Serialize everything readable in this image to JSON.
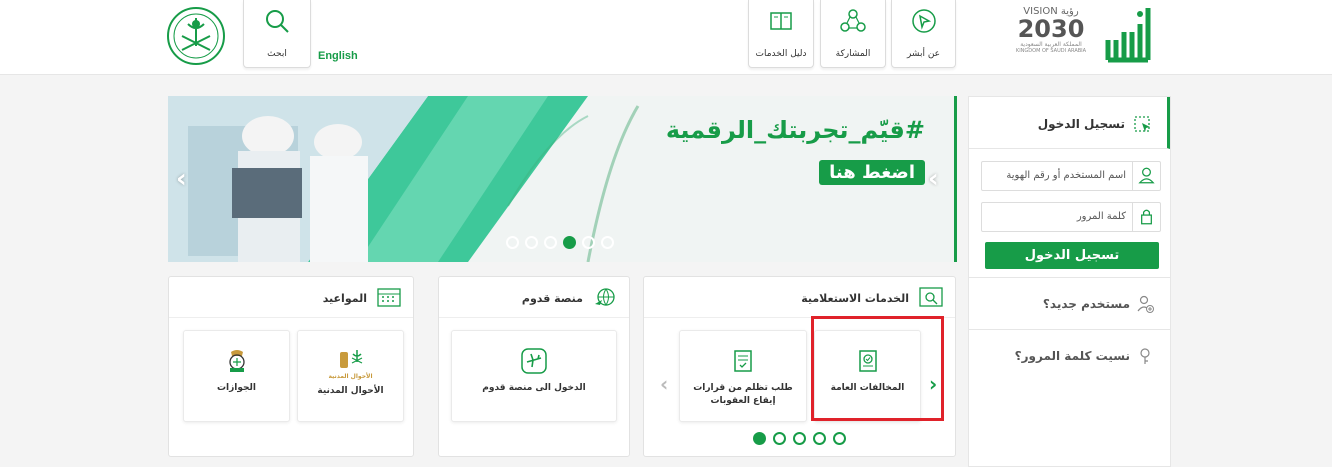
{
  "header": {
    "search_label": "ابحث",
    "english_label": "English",
    "guide_label": "دليل الخدمات",
    "participation_label": "المشاركة",
    "about_label": "عن أبشر",
    "vision_text": "VISION رؤية",
    "vision_year": "2030",
    "kingdom_ar": "المملكة العربية السعودية",
    "kingdom_en": "KINGDOM OF SAUDI ARABIA"
  },
  "banner": {
    "hashtag": "#قيّم_تجربتك_الرقمية",
    "cta": "اضغط هنا",
    "slide_count": 6,
    "active_slide": 3
  },
  "login": {
    "title": "تسجيل الدخول",
    "username_placeholder": "اسم المستخدم أو رقم الهوية",
    "password_placeholder": "كلمة المرور",
    "submit_label": "تسجيل الدخول",
    "new_user": "مستخدم جديد؟",
    "forgot_password": "نسيت كلمة المرور؟"
  },
  "inquiry": {
    "title": "الخدمات الاستعلامية",
    "tiles": [
      {
        "label": "المخالفات العامة"
      },
      {
        "label": "طلب تظلم من قرارات إيقاع العقوبات"
      }
    ],
    "page_count": 5,
    "active_page": 0
  },
  "qudoom": {
    "title": "منصة قدوم",
    "tiles": [
      {
        "label": "الدخول الى منصة قدوم"
      }
    ]
  },
  "appointments": {
    "title": "المواعيد",
    "tiles": [
      {
        "label": "الأحوال المدنية",
        "logo_text": "الأحوال المدنية"
      },
      {
        "label": "الجوازات"
      }
    ]
  },
  "colors": {
    "brand_green": "#179c48",
    "highlight_red": "#e0222a"
  },
  "icons": [
    "search-icon",
    "book-icon",
    "share-icon",
    "cursor-icon",
    "user-icon",
    "lock-icon",
    "new-user-icon",
    "key-icon",
    "calendar-icon",
    "globe-plane-icon",
    "inquiry-icon",
    "document-check-icon",
    "plane-icon"
  ]
}
